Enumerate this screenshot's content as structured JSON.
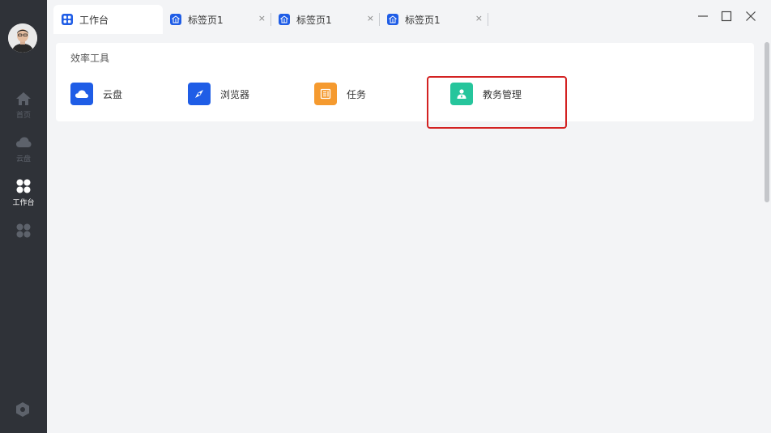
{
  "sidebar": {
    "items": [
      {
        "label": "首页",
        "icon": "home-icon"
      },
      {
        "label": "云盘",
        "icon": "cloud-icon"
      },
      {
        "label": "工作台",
        "icon": "workbench-icon",
        "active": true
      },
      {
        "label": "",
        "icon": "apps-icon"
      }
    ],
    "settings_icon": "hexagon-settings-icon"
  },
  "tabs": [
    {
      "title": "工作台",
      "active": true,
      "closable": false
    },
    {
      "title": "标签页1",
      "active": false,
      "closable": true
    },
    {
      "title": "标签页1",
      "active": false,
      "closable": true
    },
    {
      "title": "标签页1",
      "active": false,
      "closable": true
    }
  ],
  "close_symbol": "×",
  "window_controls": [
    "minimize-icon",
    "maximize-icon",
    "close-icon"
  ],
  "section": {
    "title": "效率工具",
    "tools": [
      {
        "label": "云盘",
        "icon": "cloud-icon",
        "color": "#1f5de6"
      },
      {
        "label": "浏览器",
        "icon": "compass-icon",
        "color": "#1f5de6"
      },
      {
        "label": "任务",
        "icon": "task-icon",
        "color": "#f59a2f"
      },
      {
        "label": "教务管理",
        "icon": "person-icon",
        "color": "#26c59c"
      }
    ]
  },
  "colors": {
    "sidebar_bg": "#2f3238",
    "accent": "#1f5de6",
    "highlight_border": "#d32222"
  }
}
